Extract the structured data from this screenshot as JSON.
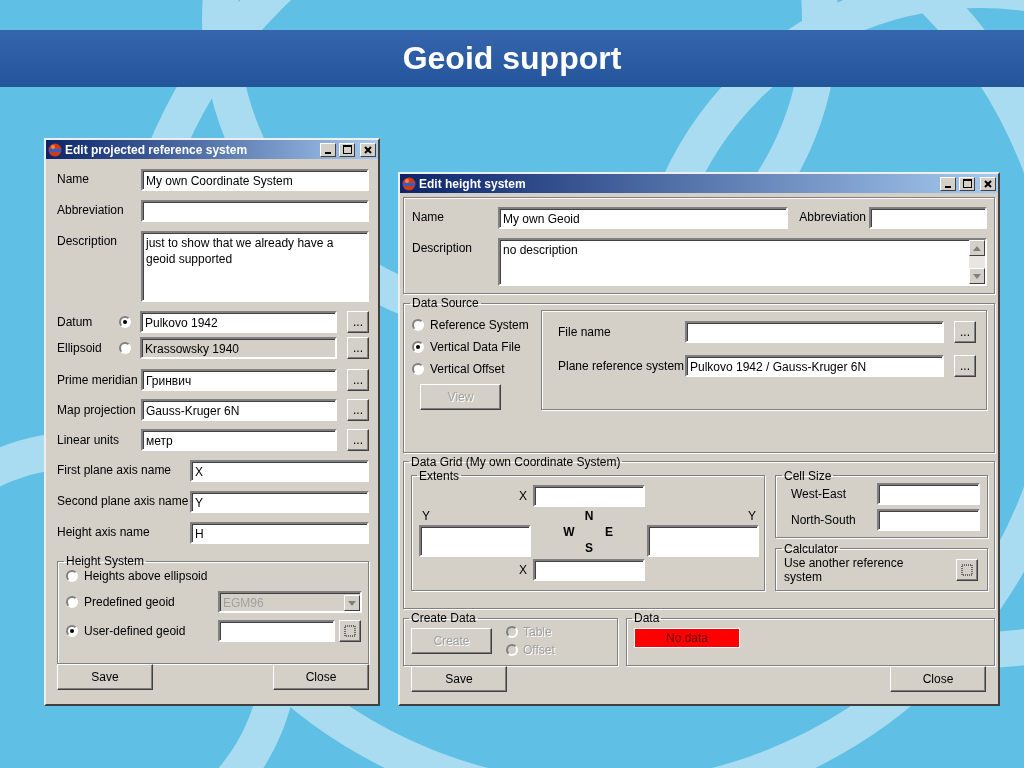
{
  "slide": {
    "title": "Geoid support"
  },
  "projected_window": {
    "title": "Edit projected reference system",
    "fields": [
      {
        "kind": "text",
        "label": "Name",
        "value": "My own Coordinate System"
      },
      {
        "kind": "text",
        "label": "Abbreviation"
      },
      {
        "kind": "memo",
        "label": "Description",
        "value": "just to show that we already have a geoid supported"
      }
    ],
    "source_choice": [
      {
        "label": "Datum",
        "selected": true,
        "value": "Pulkovo 1942",
        "button": "..."
      },
      {
        "label": "Ellipsoid",
        "selected": false,
        "value": "Krassowsky 1940",
        "button": "..."
      }
    ],
    "lookups": [
      {
        "label": "Prime meridian",
        "value": "Гринвич",
        "button": "..."
      },
      {
        "label": "Map projection",
        "value": "Gauss-Kruger 6N",
        "button": "..."
      },
      {
        "label": "Linear units",
        "value": "метр",
        "button": "..."
      }
    ],
    "axes": [
      {
        "label": "First plane axis name",
        "value": "X"
      },
      {
        "label": "Second plane axis name",
        "value": "Y"
      },
      {
        "label": "Height axis name",
        "value": "H"
      }
    ],
    "height_system": {
      "title": "Height System",
      "options": [
        {
          "kind": "plain",
          "label": "Heights above ellipsoid",
          "selected": false
        },
        {
          "kind": "dropdown",
          "label": "Predefined geoid",
          "selected": false,
          "value": "EGM96",
          "disabled": true
        },
        {
          "kind": "picker",
          "label": "User-defined geoid",
          "selected": true
        }
      ]
    },
    "buttons": [
      "Save",
      "Close"
    ]
  },
  "height_window": {
    "title": "Edit height system",
    "name": {
      "label": "Name",
      "value": "My own Geoid"
    },
    "abbreviation": {
      "label": "Abbreviation"
    },
    "description": {
      "label": "Description",
      "value": "no description"
    },
    "data_source": {
      "title": "Data Source",
      "options": [
        {
          "label": "Reference System",
          "selected": false
        },
        {
          "label": "Vertical Data File",
          "selected": true
        },
        {
          "label": "Vertical Offset",
          "selected": false
        }
      ],
      "view_button": {
        "label": "View",
        "disabled": true
      },
      "file_name": {
        "label": "File name",
        "button": "..."
      },
      "plane_reference": {
        "label": "Plane reference system",
        "value": "Pulkovo 1942 / Gauss-Kruger 6N",
        "button": "..."
      }
    },
    "data_grid": {
      "title": "Data Grid (My own Coordinate System)",
      "extents": {
        "title": "Extents",
        "top_label": "X",
        "left_label": "Y",
        "right_label": "Y",
        "bottom_label": "X",
        "compass": {
          "north": "N",
          "west": "W",
          "east": "E",
          "south": "S"
        }
      },
      "cell_size": {
        "title": "Cell Size",
        "rows": [
          {
            "label": "West-East"
          },
          {
            "label": "North-South"
          }
        ]
      },
      "calculator": {
        "title": "Calculator",
        "text": "Use another reference system"
      }
    },
    "create_data": {
      "title": "Create Data",
      "button": {
        "label": "Create",
        "disabled": true
      },
      "options": [
        {
          "label": "Table",
          "selected": false,
          "disabled": true
        },
        {
          "label": "Offset",
          "selected": false,
          "disabled": true
        }
      ]
    },
    "data": {
      "title": "Data",
      "status": "No data"
    },
    "buttons": [
      "Save",
      "Close"
    ]
  }
}
